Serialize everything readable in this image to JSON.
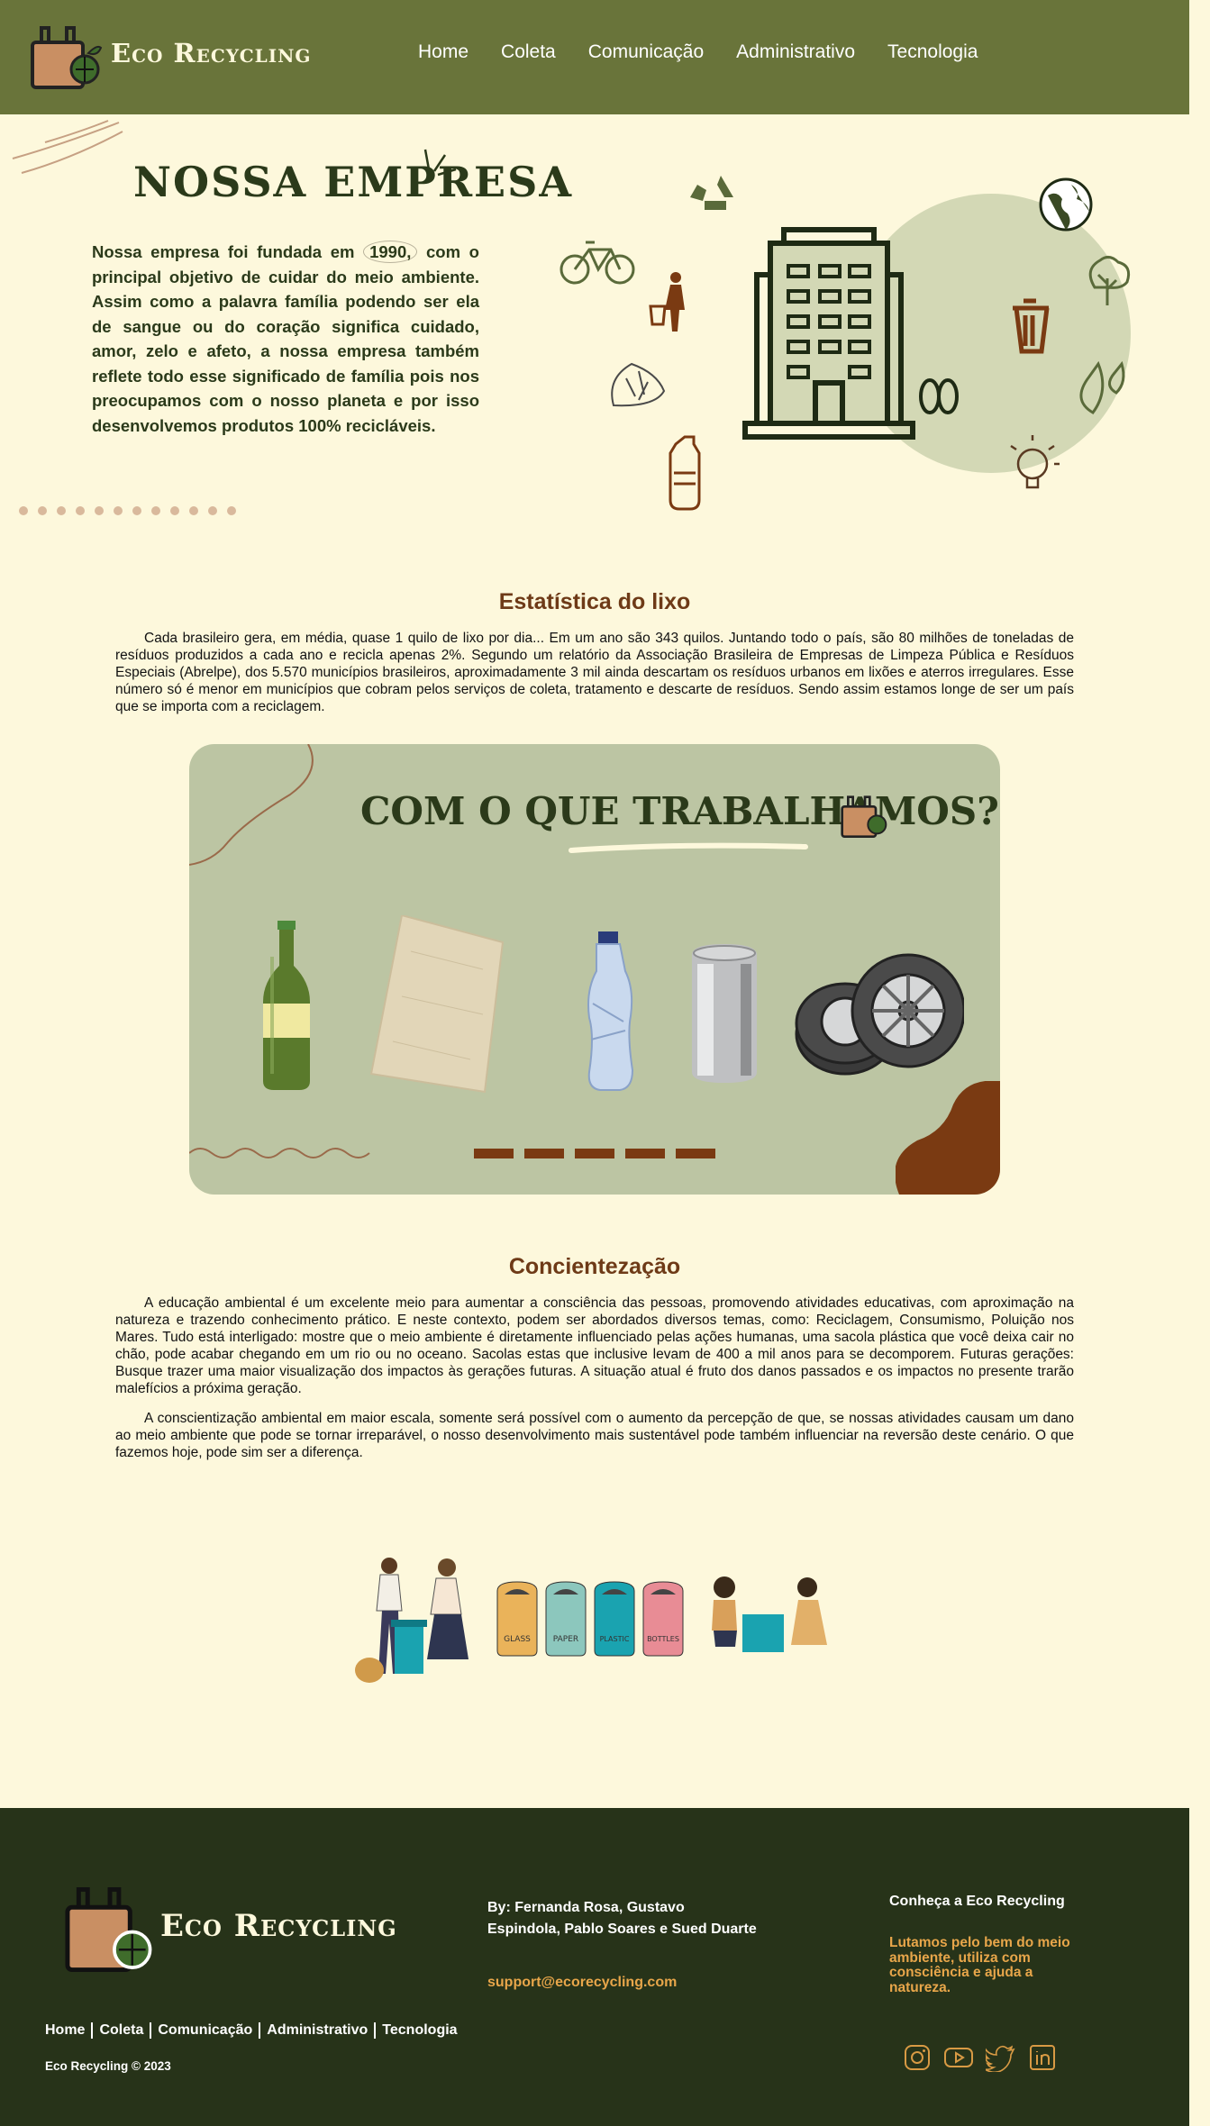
{
  "brand": {
    "name": "Eco Recycling"
  },
  "nav": [
    "Home",
    "Coleta",
    "Comunicação",
    "Administrativo",
    "Tecnologia"
  ],
  "empresa": {
    "title": "NOSSA EMPRESA",
    "text_before": "Nossa empresa foi fundada em ",
    "year": "1990,",
    "text_after": " com o principal objetivo de cuidar do meio ambiente. Assim como a palavra família podendo ser ela de sangue ou do coração significa cuidado, amor, zelo e afeto, a nossa empresa também reflete todo esse significado de família pois nos preocupamos com o nosso planeta e por isso desenvolvemos produtos 100% recicláveis."
  },
  "estatistica": {
    "title": "Estatística do lixo",
    "text": "Cada brasileiro gera, em média, quase 1 quilo de lixo por dia... Em um ano são 343 quilos. Juntando todo o país, são 80 milhões de toneladas de resíduos produzidos a cada ano e recicla apenas 2%. Segundo um relatório da Associação Brasileira de Empresas de Limpeza Pública e Resíduos Especiais (Abrelpe), dos 5.570 municípios brasileiros, aproximadamente 3 mil ainda descartam os resíduos urbanos em lixões e aterros irregulares. Esse número só é menor em municípios que cobram pelos serviços de coleta, tratamento e descarte de resíduos. Sendo assim estamos longe de ser um país que se importa com a reciclagem."
  },
  "card": {
    "title": "COM O QUE TRABALHAMOS?"
  },
  "conscientizacao": {
    "title": "Concientezação",
    "p1": "A educação ambiental é um excelente meio para aumentar a consciência das pessoas, promovendo atividades educativas, com aproximação na natureza e trazendo conhecimento prático. E neste contexto, podem ser abordados diversos temas, como: Reciclagem, Consumismo, Poluição nos Mares. Tudo está interligado: mostre que o meio ambiente é diretamente influenciado pelas ações humanas, uma sacola plástica que você deixa cair no chão, pode acabar chegando em um rio ou no oceano. Sacolas estas que inclusive levam de 400 a mil anos para se decomporem. Futuras gerações: Busque trazer uma maior visualização dos impactos às gerações futuras. A situação atual é fruto dos danos passados e os impactos no presente trarão malefícios a próxima geração.",
    "p2": "A conscientização ambiental em maior escala, somente será possível com o aumento da percepção de que, se nossas atividades causam um dano ao meio ambiente que pode se tornar irreparável, o nosso desenvolvimento mais sustentável pode também influenciar na reversão deste cenário. O que fazemos hoje, pode sim ser a diferença."
  },
  "bins": [
    "GLASS",
    "PAPER",
    "PLASTIC",
    "BOTTLES"
  ],
  "footer": {
    "nav": [
      "Home",
      "Coleta",
      "Comunicação",
      "Administrativo",
      "Tecnologia"
    ],
    "copyright": "Eco Recycling © 2023",
    "authors": "By: Fernanda Rosa, Gustavo Espindola, Pablo Soares e Sued Duarte",
    "email": "support@ecorecycling.com",
    "know": "Conheça a Eco Recycling",
    "tagline": "Lutamos pelo bem do meio ambiente, utiliza com consciência e ajuda a natureza."
  },
  "colors": {
    "header": "#69743a",
    "background": "#fdf8dc",
    "accent": "#6e3a17",
    "footer": "#273319",
    "link_orange": "#e8a64a"
  },
  "icons": [
    "recycle-bag-icon",
    "recycle-icon",
    "globe-icon",
    "bicycle-icon",
    "person-trash-icon",
    "trash-can-icon",
    "tree-icon",
    "leaves-icon",
    "bottle-icon",
    "lightbulb-icon",
    "building-icon",
    "instagram-icon",
    "youtube-icon",
    "twitter-icon",
    "linkedin-icon"
  ]
}
